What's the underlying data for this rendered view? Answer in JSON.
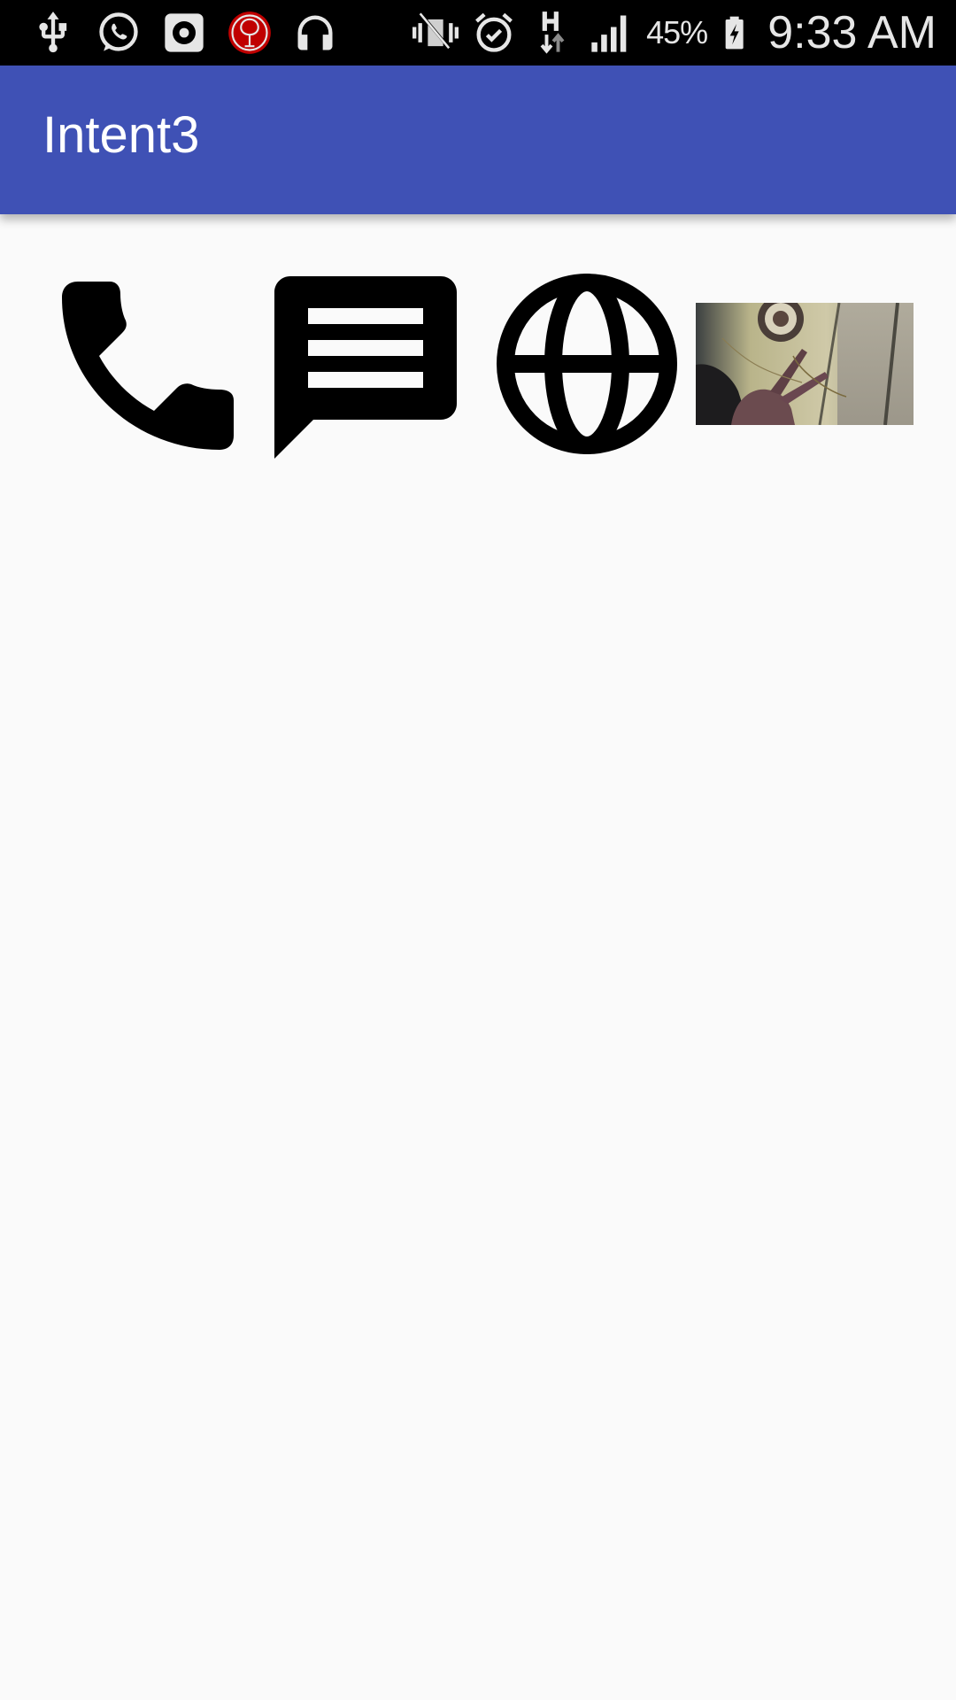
{
  "status_bar": {
    "left_icons": [
      "usb-icon",
      "whatsapp-icon",
      "media-icon",
      "app-notification-icon",
      "headphones-icon"
    ],
    "right_icons": [
      "vibrate-mute-icon",
      "alarm-icon",
      "data-h-icon",
      "signal-icon"
    ],
    "battery_percent": "45%",
    "time": "9:33 AM",
    "colors": {
      "background": "#000000",
      "icons": "#e6e6e6",
      "notification_badge": "#c00000"
    }
  },
  "app_bar": {
    "title": "Intent3",
    "color": "#3f51b5"
  },
  "actions": [
    {
      "name": "call",
      "icon": "phone-icon"
    },
    {
      "name": "message",
      "icon": "message-icon"
    },
    {
      "name": "web",
      "icon": "globe-icon"
    },
    {
      "name": "camera-photo",
      "icon": "photo-thumbnail"
    }
  ],
  "colors": {
    "accent": "#3f51b5",
    "background": "#fafafa",
    "icon": "#000000"
  }
}
